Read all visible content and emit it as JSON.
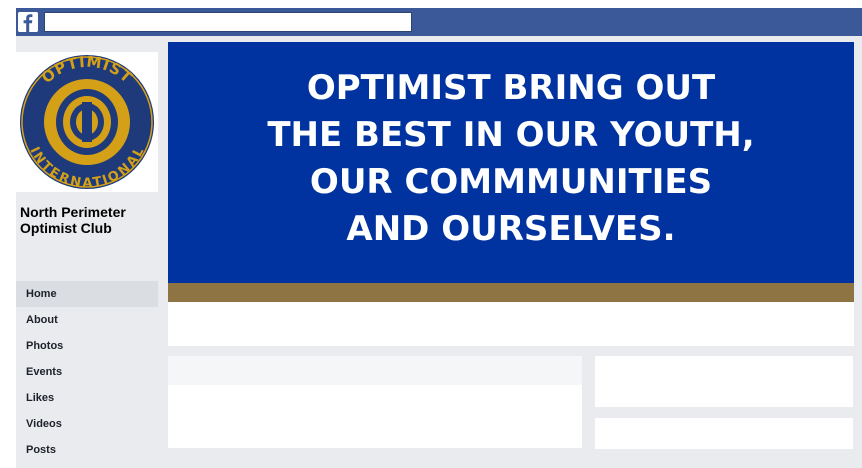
{
  "topbar": {
    "logo_icon": "facebook-f-icon",
    "search_value": "",
    "colors": {
      "bar": "#3b5998",
      "frame": "#e9ebee"
    }
  },
  "page": {
    "name_line1": "North Perimeter",
    "name_line2": "Optimist Club",
    "logo": {
      "icon": "optimist-international-emblem",
      "ring_text_top": "OPTIMIST",
      "ring_text_bottom": "INTERNATIONAL",
      "colors": {
        "navy": "#1e3a7b",
        "gold": "#d4a017"
      }
    }
  },
  "nav": {
    "items": [
      {
        "label": "Home",
        "active": true
      },
      {
        "label": "About"
      },
      {
        "label": "Photos"
      },
      {
        "label": "Events"
      },
      {
        "label": "Likes"
      },
      {
        "label": "Videos"
      },
      {
        "label": "Posts"
      }
    ]
  },
  "cover": {
    "headline": "OPTIMIST BRING OUT\nTHE BEST IN OUR YOUTH,\nOUR COMMMUNITIES\nAND OURSELVES.",
    "colors": {
      "background": "#0033a0",
      "stripe": "#8f7443",
      "text": "#ffffff"
    }
  }
}
